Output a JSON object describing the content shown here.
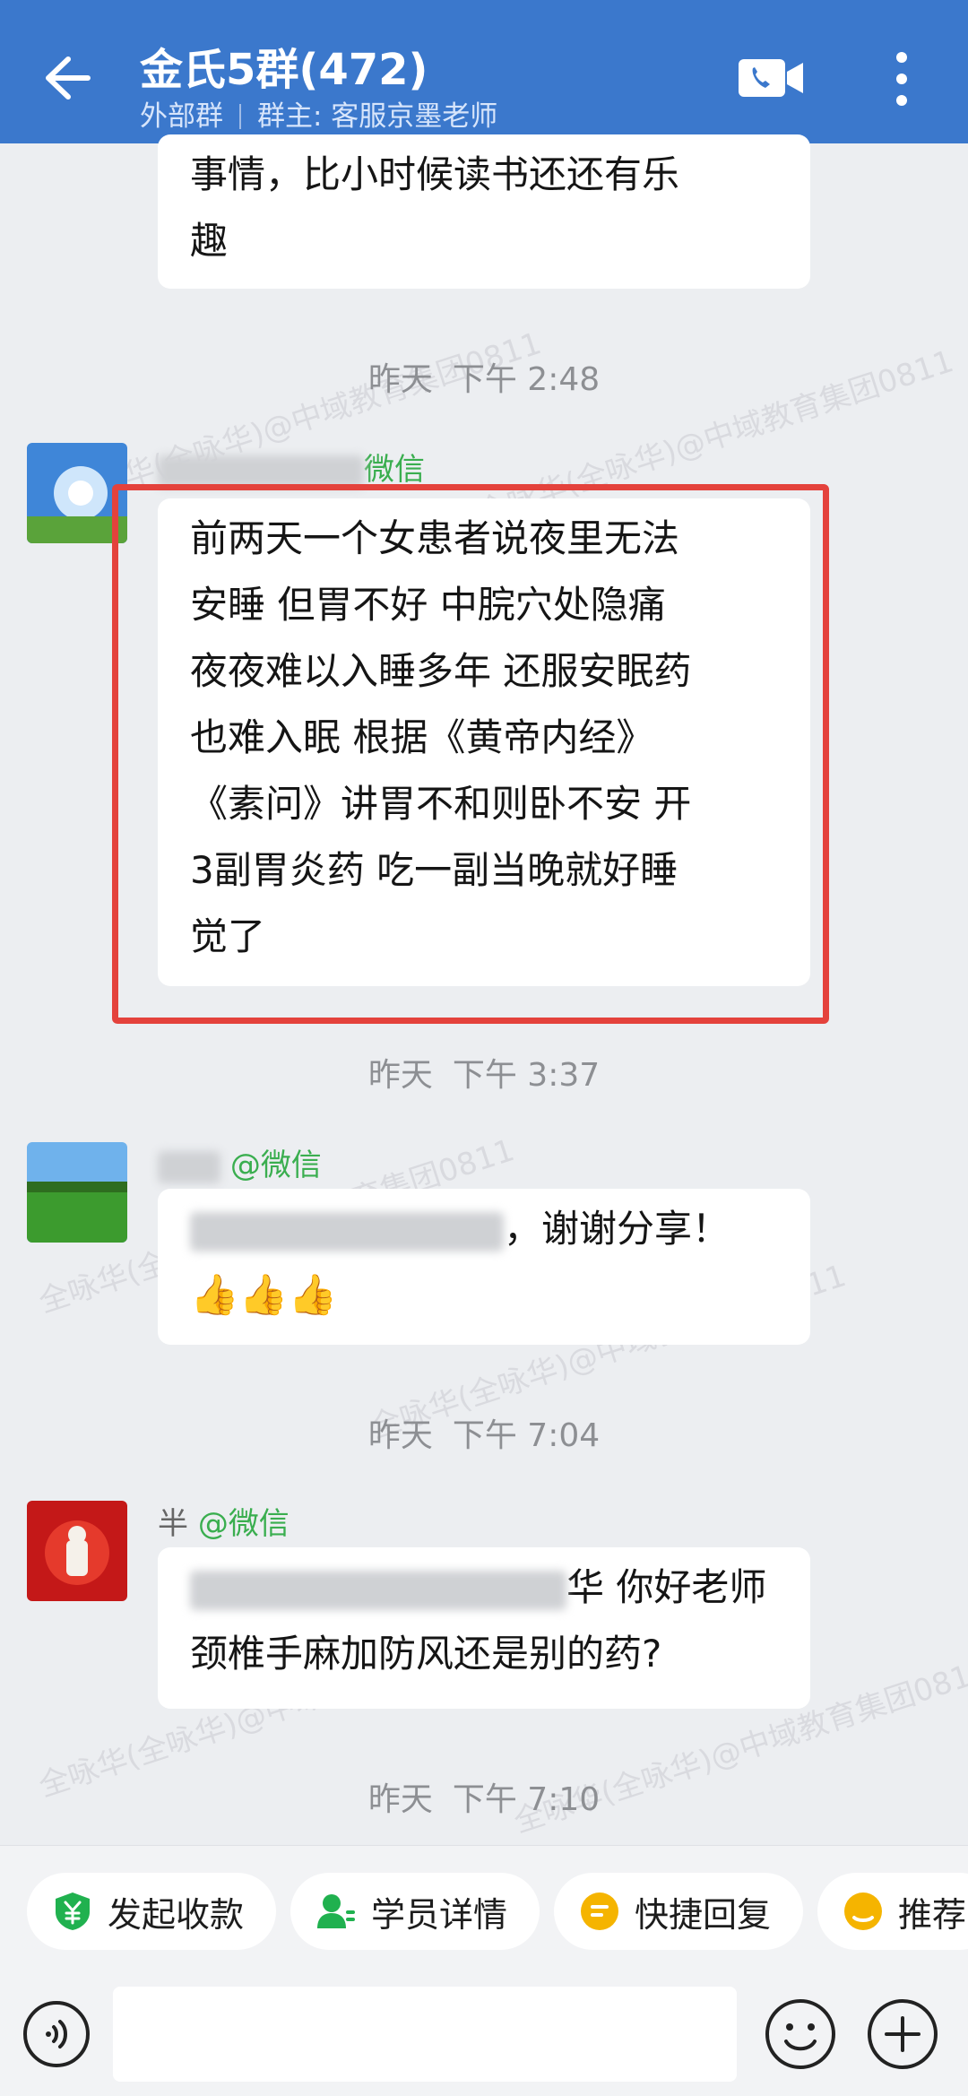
{
  "header": {
    "title": "金氏5群(472)",
    "group_type": "外部群",
    "owner": "群主: 客服京墨老师"
  },
  "messages": [
    {
      "text_line1": "事情，比小时候读书还还有乐",
      "text_line2": "趣"
    },
    {
      "timestamp_day": "昨天",
      "timestamp_time": "下午 2:48",
      "sender_suffix": "微信",
      "lines": [
        "前两天一个女患者说夜里无法",
        "安睡 但胃不好  中脘穴处隐痛",
        "夜夜难以入睡多年 还服安眠药",
        "也难入眠  根据《黄帝内经》",
        "《素问》讲胃不和则卧不安 开",
        "3副胃炎药 吃一副当晚就好睡",
        "觉了"
      ]
    },
    {
      "timestamp_day": "昨天",
      "timestamp_time": "下午 3:37",
      "sender_suffix": "@微信",
      "text_line1_end": "，谢谢分享！",
      "emoji": "👍👍👍"
    },
    {
      "timestamp_day": "昨天",
      "timestamp_time": "下午 7:04",
      "sender_visible": "半",
      "sender_suffix": "@微信",
      "text_line1_end": "华 你好老师",
      "text_line2": "颈椎手麻加防风还是别的药?"
    },
    {
      "timestamp_day": "昨天",
      "timestamp_time": "下午 7:10"
    }
  ],
  "quick_actions": [
    {
      "label": "发起收款",
      "icon": "yuan-shield-icon",
      "color": "#20b14f"
    },
    {
      "label": "学员详情",
      "icon": "user-card-icon",
      "color": "#20b14f"
    },
    {
      "label": "快捷回复",
      "icon": "quick-reply-icon",
      "color": "#f5b400"
    },
    {
      "label": "推荐",
      "icon": "recommend-icon",
      "color": "#f5b400"
    }
  ],
  "watermark_text": "全咏华(全咏华)@中域教育集团0811",
  "colors": {
    "header": "#3b78cc",
    "highlight": "#e4423c",
    "wechat_green": "#3aae4f"
  }
}
